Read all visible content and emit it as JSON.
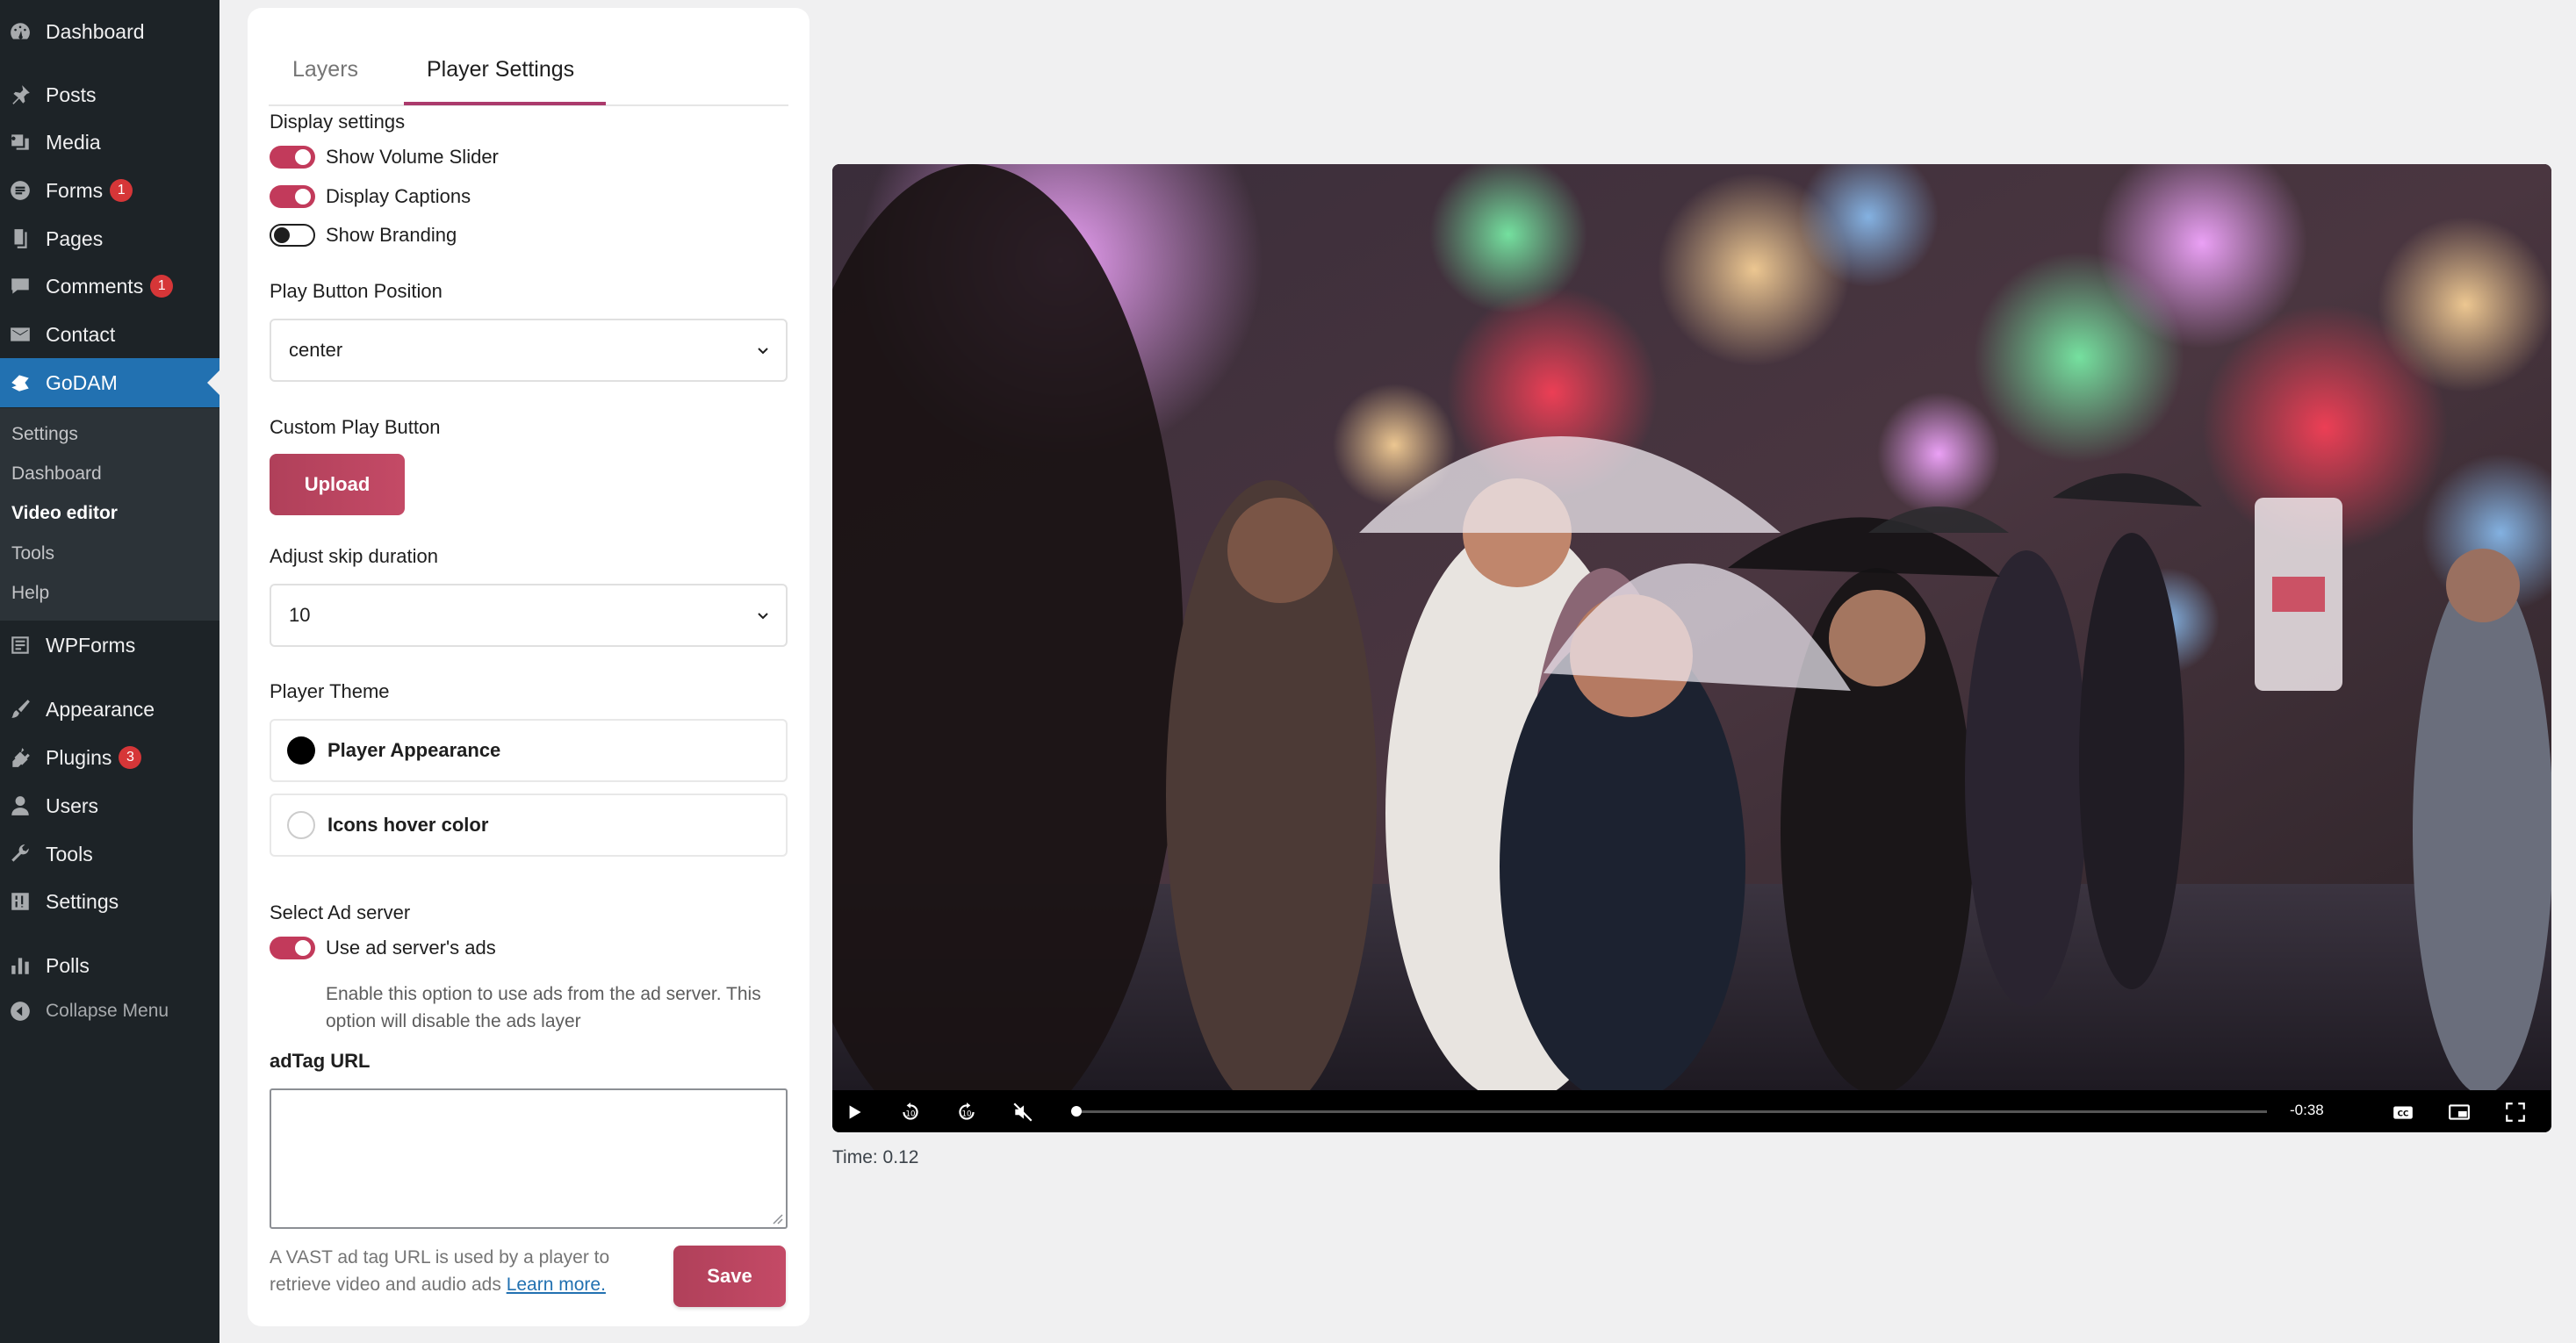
{
  "sidebar": {
    "items": [
      {
        "label": "Dashboard",
        "icon": "dashboard-icon"
      },
      {
        "label": "Posts",
        "icon": "pin-icon"
      },
      {
        "label": "Media",
        "icon": "media-icon"
      },
      {
        "label": "Forms",
        "icon": "forms-icon",
        "badge": "1"
      },
      {
        "label": "Pages",
        "icon": "pages-icon"
      },
      {
        "label": "Comments",
        "icon": "comments-icon",
        "badge": "1"
      },
      {
        "label": "Contact",
        "icon": "envelope-icon"
      },
      {
        "label": "GoDAM",
        "icon": "godam-icon"
      },
      {
        "label": "WPForms",
        "icon": "wpforms-icon"
      },
      {
        "label": "Appearance",
        "icon": "brush-icon"
      },
      {
        "label": "Plugins",
        "icon": "plugin-icon",
        "badge": "3"
      },
      {
        "label": "Users",
        "icon": "user-icon"
      },
      {
        "label": "Tools",
        "icon": "wrench-icon"
      },
      {
        "label": "Settings",
        "icon": "settings-icon"
      },
      {
        "label": "Polls",
        "icon": "chart-icon"
      }
    ],
    "submenu": [
      "Settings",
      "Dashboard",
      "Video editor",
      "Tools",
      "Help"
    ],
    "collapse_label": "Collapse Menu"
  },
  "panel": {
    "tabs": [
      "Layers",
      "Player Settings"
    ],
    "display_settings_label": "Display settings",
    "toggles": {
      "volume": "Show Volume Slider",
      "captions": "Display Captions",
      "branding": "Show Branding"
    },
    "play_button_position_label": "Play Button Position",
    "play_button_position_value": "center",
    "custom_play_button_label": "Custom Play Button",
    "upload_label": "Upload",
    "skip_duration_label": "Adjust skip duration",
    "skip_duration_value": "10",
    "player_theme_label": "Player Theme",
    "player_appearance_label": "Player Appearance",
    "icons_hover_label": "Icons hover color",
    "ad_server_label": "Select Ad server",
    "ad_server_toggle": "Use ad server's ads",
    "ad_server_help": "Enable this option to use ads from the ad server. This option will disable the ads layer",
    "adtag_label": "adTag URL",
    "adtag_value": "",
    "footnote_text": "A VAST ad tag URL is used by a player to retrieve video and audio ads",
    "footnote_link": "Learn more.",
    "save_label": "Save"
  },
  "colors": {
    "accent": "#c23a5b",
    "player_appearance": "#000000",
    "icons_hover": "#ffffff",
    "sidebar_bg": "#1d2327",
    "current_menu": "#2271b1"
  },
  "video": {
    "remaining": "-0:38",
    "progress": 0.003,
    "controls": [
      "play-icon",
      "rewind-10-icon",
      "forward-10-icon",
      "mute-icon",
      "cc-icon",
      "pip-icon",
      "fullscreen-icon"
    ]
  },
  "time_caption": "Time: 0.12"
}
